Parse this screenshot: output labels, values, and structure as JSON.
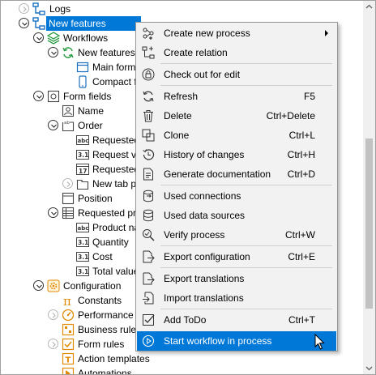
{
  "tree": {
    "rows": [
      {
        "id": "logs",
        "label": "Logs"
      },
      {
        "id": "new-features",
        "label": "New features"
      },
      {
        "id": "workflows",
        "label": "Workflows"
      },
      {
        "id": "new-features-sub",
        "label": "New features ("
      },
      {
        "id": "main-form",
        "label": "Main form"
      },
      {
        "id": "compact-form",
        "label": "Compact fo"
      },
      {
        "id": "form-fields",
        "label": "Form fields"
      },
      {
        "id": "name",
        "label": "Name"
      },
      {
        "id": "order",
        "label": "Order"
      },
      {
        "id": "requested-1",
        "label": "Requested"
      },
      {
        "id": "request-va",
        "label": "Request va"
      },
      {
        "id": "requested-2",
        "label": "Requested"
      },
      {
        "id": "new-tab",
        "label": "New tab pa"
      },
      {
        "id": "position",
        "label": "Position"
      },
      {
        "id": "requested-prod",
        "label": "Requested proc"
      },
      {
        "id": "product-name",
        "label": "Product nar"
      },
      {
        "id": "quantity",
        "label": "Quantity"
      },
      {
        "id": "cost",
        "label": "Cost"
      },
      {
        "id": "total-value",
        "label": "Total value"
      },
      {
        "id": "configuration",
        "label": "Configuration"
      },
      {
        "id": "constants",
        "label": "Constants"
      },
      {
        "id": "performance",
        "label": "Performance in"
      },
      {
        "id": "business-rules",
        "label": "Business rules"
      },
      {
        "id": "form-rules",
        "label": "Form rules"
      },
      {
        "id": "action-templates",
        "label": "Action templates"
      },
      {
        "id": "automations",
        "label": "Automations"
      }
    ]
  },
  "menu": {
    "items": [
      {
        "id": "create-new-process",
        "label": "Create new process",
        "shortcut": ""
      },
      {
        "id": "create-relation",
        "label": "Create relation",
        "shortcut": ""
      },
      {
        "id": "check-out",
        "label": "Check out for edit",
        "shortcut": ""
      },
      {
        "id": "refresh",
        "label": "Refresh",
        "shortcut": "F5"
      },
      {
        "id": "delete",
        "label": "Delete",
        "shortcut": "Ctrl+Delete"
      },
      {
        "id": "clone",
        "label": "Clone",
        "shortcut": "Ctrl+L"
      },
      {
        "id": "history",
        "label": "History of changes",
        "shortcut": "Ctrl+H"
      },
      {
        "id": "generate-doc",
        "label": "Generate documentation",
        "shortcut": "Ctrl+D"
      },
      {
        "id": "used-connections",
        "label": "Used connections",
        "shortcut": ""
      },
      {
        "id": "used-data-sources",
        "label": "Used data sources",
        "shortcut": ""
      },
      {
        "id": "verify-process",
        "label": "Verify process",
        "shortcut": "Ctrl+W"
      },
      {
        "id": "export-config",
        "label": "Export configuration",
        "shortcut": "Ctrl+E"
      },
      {
        "id": "export-translations",
        "label": "Export translations",
        "shortcut": ""
      },
      {
        "id": "import-translations",
        "label": "Import translations",
        "shortcut": ""
      },
      {
        "id": "add-todo",
        "label": "Add ToDo",
        "shortcut": "Ctrl+T"
      },
      {
        "id": "start-workflow",
        "label": "Start workflow in process",
        "shortcut": ""
      }
    ]
  },
  "colors": {
    "accent": "#0078d7",
    "icon_blue": "#1b6fc0",
    "icon_green": "#2e9e48",
    "icon_orange": "#e08a00"
  }
}
